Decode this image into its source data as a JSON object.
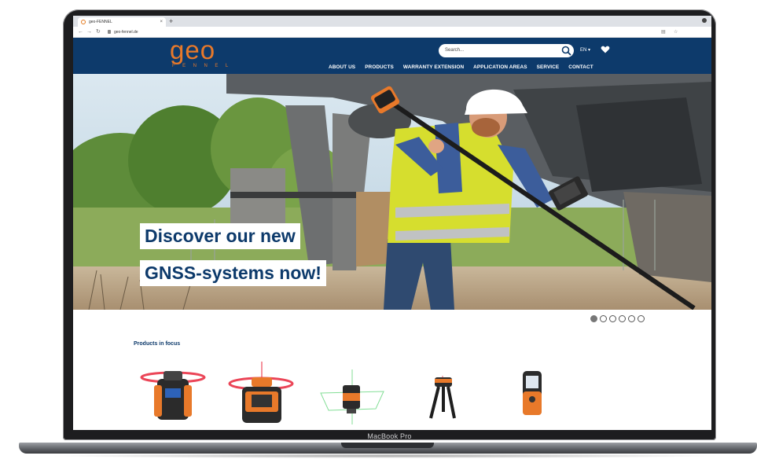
{
  "browser": {
    "tab_title": "geo-FENNEL",
    "new_tab": "+",
    "tab_close": "×",
    "url": "geo-fennel.de"
  },
  "device": {
    "label": "MacBook Pro"
  },
  "site": {
    "logo_main": "geo",
    "logo_sub": "FENNEL",
    "search_placeholder": "Search...",
    "language": "EN ▾",
    "nav": [
      {
        "label": "ABOUT US"
      },
      {
        "label": "PRODUCTS"
      },
      {
        "label": "WARRANTY EXTENSION"
      },
      {
        "label": "APPLICATION AREAS"
      },
      {
        "label": "SERVICE"
      },
      {
        "label": "CONTACT"
      }
    ],
    "brand_color": "#0d3a6b",
    "accent_color": "#e8792a"
  },
  "hero": {
    "line1": "Discover our new",
    "line2": "GNSS-systems now!",
    "slide_count": 6,
    "active_slide": 1
  },
  "products": {
    "title": "Products in focus",
    "items": [
      {
        "icon": "rotating-laser-icon"
      },
      {
        "icon": "rotating-laser-icon"
      },
      {
        "icon": "cross-line-laser-icon"
      },
      {
        "icon": "tripod-laser-icon"
      },
      {
        "icon": "digital-detector-icon"
      }
    ]
  }
}
